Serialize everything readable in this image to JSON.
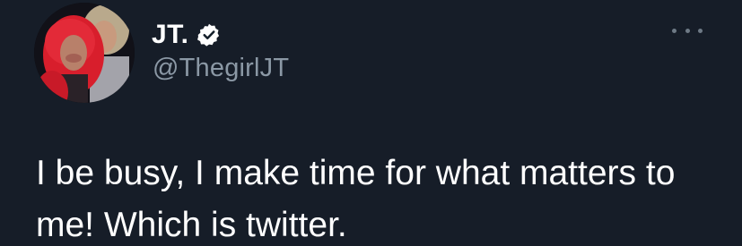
{
  "author": {
    "display_name": "JT.",
    "handle": "@ThegirlJT",
    "verified": true,
    "avatar_icon": "profile-photo"
  },
  "tweet": {
    "text": "I be busy, I make time for what matters to me! Which is twitter."
  },
  "menu": {
    "icon": "more-options-icon"
  },
  "colors": {
    "background": "#15202b",
    "text_primary": "#ffffff",
    "text_secondary": "#8b98a5",
    "verified_badge": "#ffffff"
  }
}
